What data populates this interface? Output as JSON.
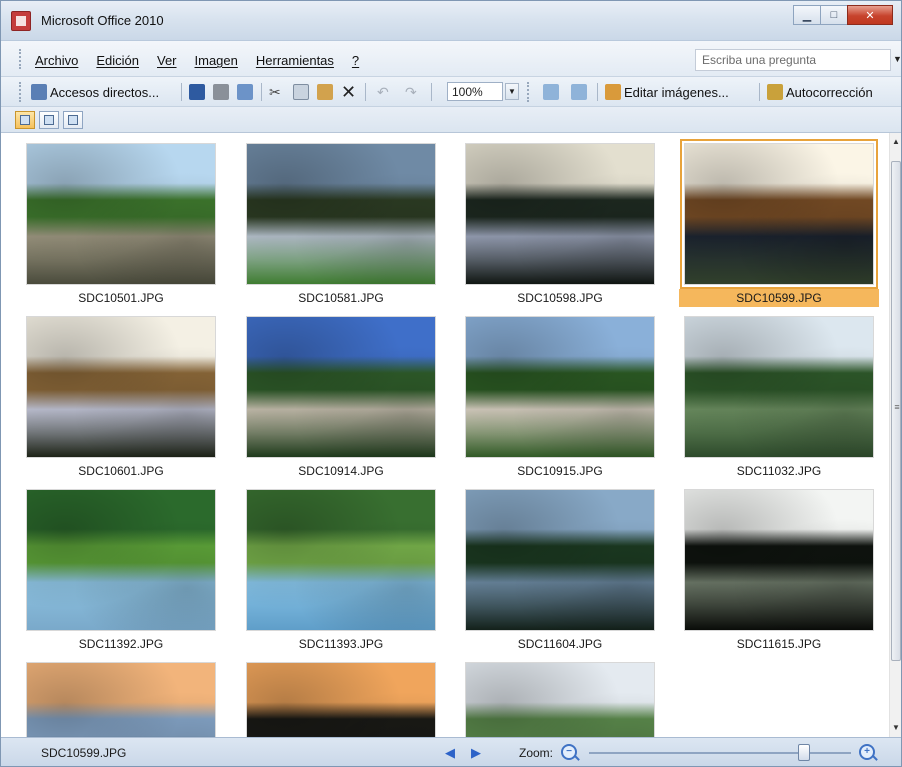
{
  "window": {
    "title": "Microsoft Office 2010"
  },
  "menu": {
    "items": [
      {
        "label": "Archivo"
      },
      {
        "label": "Edición"
      },
      {
        "label": "Ver"
      },
      {
        "label": "Imagen"
      },
      {
        "label": "Herramientas"
      },
      {
        "label": "?"
      }
    ],
    "ask_placeholder": "Escriba una pregunta"
  },
  "toolbar": {
    "shortcuts_label": "Accesos directos...",
    "zoom_value": "100%",
    "edit_images_label": "Editar imágenes...",
    "autocorrect_label": "Autocorrección"
  },
  "gallery": {
    "images": [
      {
        "file": "SDC10501.JPG",
        "selected": false,
        "colors": [
          "#b7d7ef",
          "#3f7a2e",
          "#9c9680",
          "#4a4b3c"
        ]
      },
      {
        "file": "SDC10581.JPG",
        "selected": false,
        "colors": [
          "#6f8aa5",
          "#2d3d24",
          "#b8c4cf",
          "#3f7d31"
        ]
      },
      {
        "file": "SDC10598.JPG",
        "selected": false,
        "colors": [
          "#e3dfcf",
          "#1e2a21",
          "#98a1b6",
          "#101612"
        ]
      },
      {
        "file": "SDC10599.JPG",
        "selected": true,
        "colors": [
          "#fbf5e6",
          "#7a4e26",
          "#1c2430",
          "#31402b"
        ]
      },
      {
        "file": "SDC10601.JPG",
        "selected": false,
        "colors": [
          "#f4f0e4",
          "#8e6a3a",
          "#c2c5d7",
          "#1d2317"
        ]
      },
      {
        "file": "SDC10914.JPG",
        "selected": false,
        "colors": [
          "#3f6fc9",
          "#2f5d2a",
          "#c6bfae",
          "#1e3a1b"
        ]
      },
      {
        "file": "SDC10915.JPG",
        "selected": false,
        "colors": [
          "#8ab0d9",
          "#2c5c24",
          "#d8d0c2",
          "#315a26"
        ]
      },
      {
        "file": "SDC11032.JPG",
        "selected": false,
        "colors": [
          "#dce7ef",
          "#2f5b2b",
          "#6c8f61",
          "#2d4a2b"
        ]
      },
      {
        "file": "SDC11392.JPG",
        "selected": false,
        "colors": [
          "#2b6a2c",
          "#5fa63a",
          "#8cc1e0",
          "#7aa9ca"
        ]
      },
      {
        "file": "SDC11393.JPG",
        "selected": false,
        "colors": [
          "#386f30",
          "#79b34c",
          "#86c2e6",
          "#5f9ec9"
        ]
      },
      {
        "file": "SDC11604.JPG",
        "selected": false,
        "colors": [
          "#88a9c7",
          "#1c3b22",
          "#6b88a0",
          "#13211a"
        ]
      },
      {
        "file": "SDC11615.JPG",
        "selected": false,
        "colors": [
          "#f3f5f3",
          "#0f140f",
          "#6c7868",
          "#0a0c09"
        ]
      },
      {
        "file": "",
        "selected": false,
        "colors": [
          "#f2b47b",
          "#86a6c9",
          "#243129",
          "#151b18"
        ]
      },
      {
        "file": "",
        "selected": false,
        "colors": [
          "#f0a55c",
          "#1a1a16",
          "#5d6f72",
          "#0f100e"
        ]
      },
      {
        "file": "",
        "selected": false,
        "colors": [
          "#e4eaf0",
          "#5c8b4d",
          "#7a7d6a",
          "#3e5c37"
        ]
      }
    ]
  },
  "status": {
    "selected_file": "SDC10599.JPG",
    "zoom_label": "Zoom:",
    "zoom_level": 0.82
  }
}
